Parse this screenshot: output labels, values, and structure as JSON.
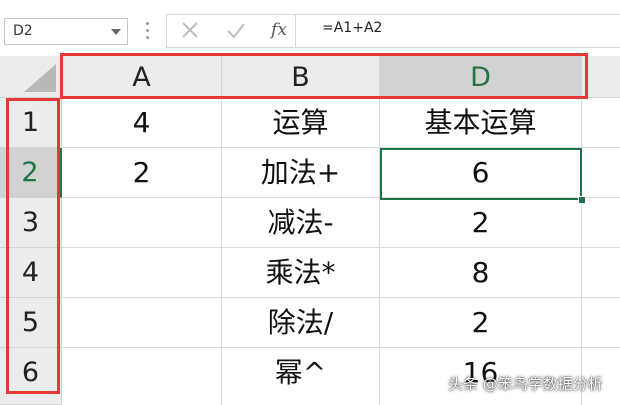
{
  "name_box": {
    "value": "D2"
  },
  "formula_bar": {
    "cancel_icon": "close-x",
    "enter_icon": "check-mark",
    "fx_label": "fx",
    "formula": "=A1+A2"
  },
  "columns": [
    "A",
    "B",
    "D"
  ],
  "rows": [
    "1",
    "2",
    "3",
    "4",
    "5",
    "6"
  ],
  "cells": [
    [
      "4",
      "运算",
      "基本运算"
    ],
    [
      "2",
      "加法+",
      "6"
    ],
    [
      "",
      "减法-",
      "2"
    ],
    [
      "",
      "乘法*",
      "8"
    ],
    [
      "",
      "除法/",
      "2"
    ],
    [
      "",
      "幂^",
      "16"
    ]
  ],
  "active": {
    "column": "D",
    "row": "2"
  },
  "highlight_color": "#e53935",
  "accent_color": "#217346",
  "watermark": "头条 @笨鸟学数据分析"
}
